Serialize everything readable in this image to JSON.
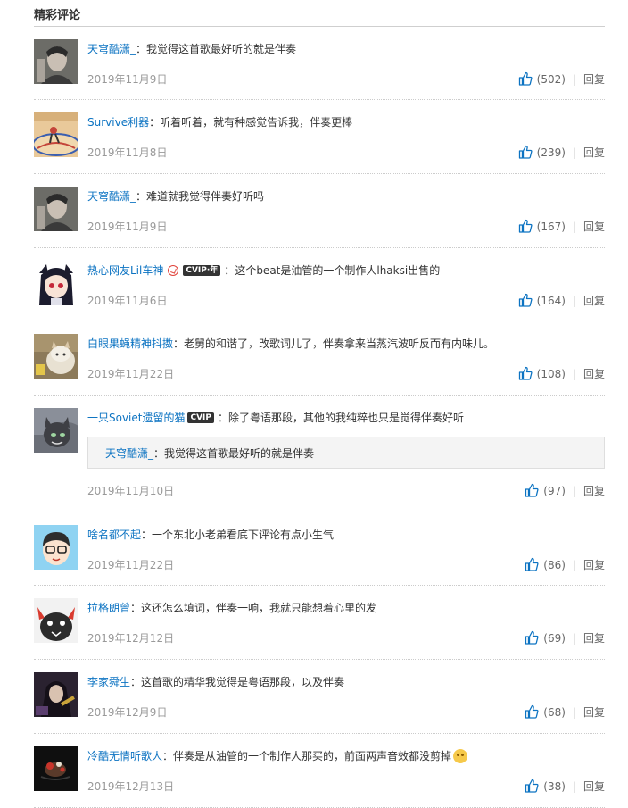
{
  "section_title": "精彩评论",
  "colors": {
    "user_link": "#0c73c2",
    "meta": "#999999",
    "like_icon": "#0c73c2"
  },
  "comments": [
    {
      "user": "天穹酷潇_",
      "sep": "：",
      "text": "我觉得这首歌最好听的就是伴奏",
      "time": "2019年11月9日",
      "likes": "(502)",
      "reply": "回复"
    },
    {
      "user": "Survive利器",
      "sep": "：",
      "text": "听着听着，就有种感觉告诉我，伴奏更棒",
      "time": "2019年11月8日",
      "likes": "(239)",
      "reply": "回复"
    },
    {
      "user": "天穹酷潇_",
      "sep": "：",
      "text": "难道就我觉得伴奏好听吗",
      "time": "2019年11月9日",
      "likes": "(167)",
      "reply": "回复"
    },
    {
      "user": "热心网友Lil车神",
      "badge": "CVIP·年",
      "sep": "：",
      "text": "这个beat是油管的一个制作人lhaksi出售的",
      "time": "2019年11月6日",
      "likes": "(164)",
      "reply": "回复"
    },
    {
      "user": "白眼果蝇精神抖擞",
      "sep": "：",
      "text": "老舅的和谐了，改歌词儿了，伴奏拿来当蒸汽波听反而有内味儿。",
      "time": "2019年11月22日",
      "likes": "(108)",
      "reply": "回复"
    },
    {
      "user": "一只Soviet遗留的猫",
      "badge": "CVIP",
      "sep": "：",
      "text": "除了粤语那段，其他的我纯粹也只是觉得伴奏好听",
      "quote_user": "天穹酷潇_",
      "quote_sep": "：",
      "quote_text": "我觉得这首歌最好听的就是伴奏",
      "time": "2019年11月10日",
      "likes": "(97)",
      "reply": "回复"
    },
    {
      "user": "啥名都不起",
      "sep": "：",
      "text": "一个东北小老弟看底下评论有点小生气",
      "time": "2019年11月22日",
      "likes": "(86)",
      "reply": "回复"
    },
    {
      "user": "拉格朗曾",
      "sep": "：",
      "text": "这还怎么填词，伴奏一响，我就只能想着心里的发",
      "time": "2019年12月12日",
      "likes": "(69)",
      "reply": "回复"
    },
    {
      "user": "李家舜生",
      "sep": "：",
      "text": "这首歌的精华我觉得是粤语那段，以及伴奏",
      "time": "2019年12月9日",
      "likes": "(68)",
      "reply": "回复"
    },
    {
      "user": "冷酷无情听歌人",
      "sep": "：",
      "text": "伴奏是从油管的一个制作人那买的，前面两声音效都没剪掉",
      "emoji": "crying-emoji",
      "time": "2019年12月13日",
      "likes": "(38)",
      "reply": "回复"
    }
  ]
}
